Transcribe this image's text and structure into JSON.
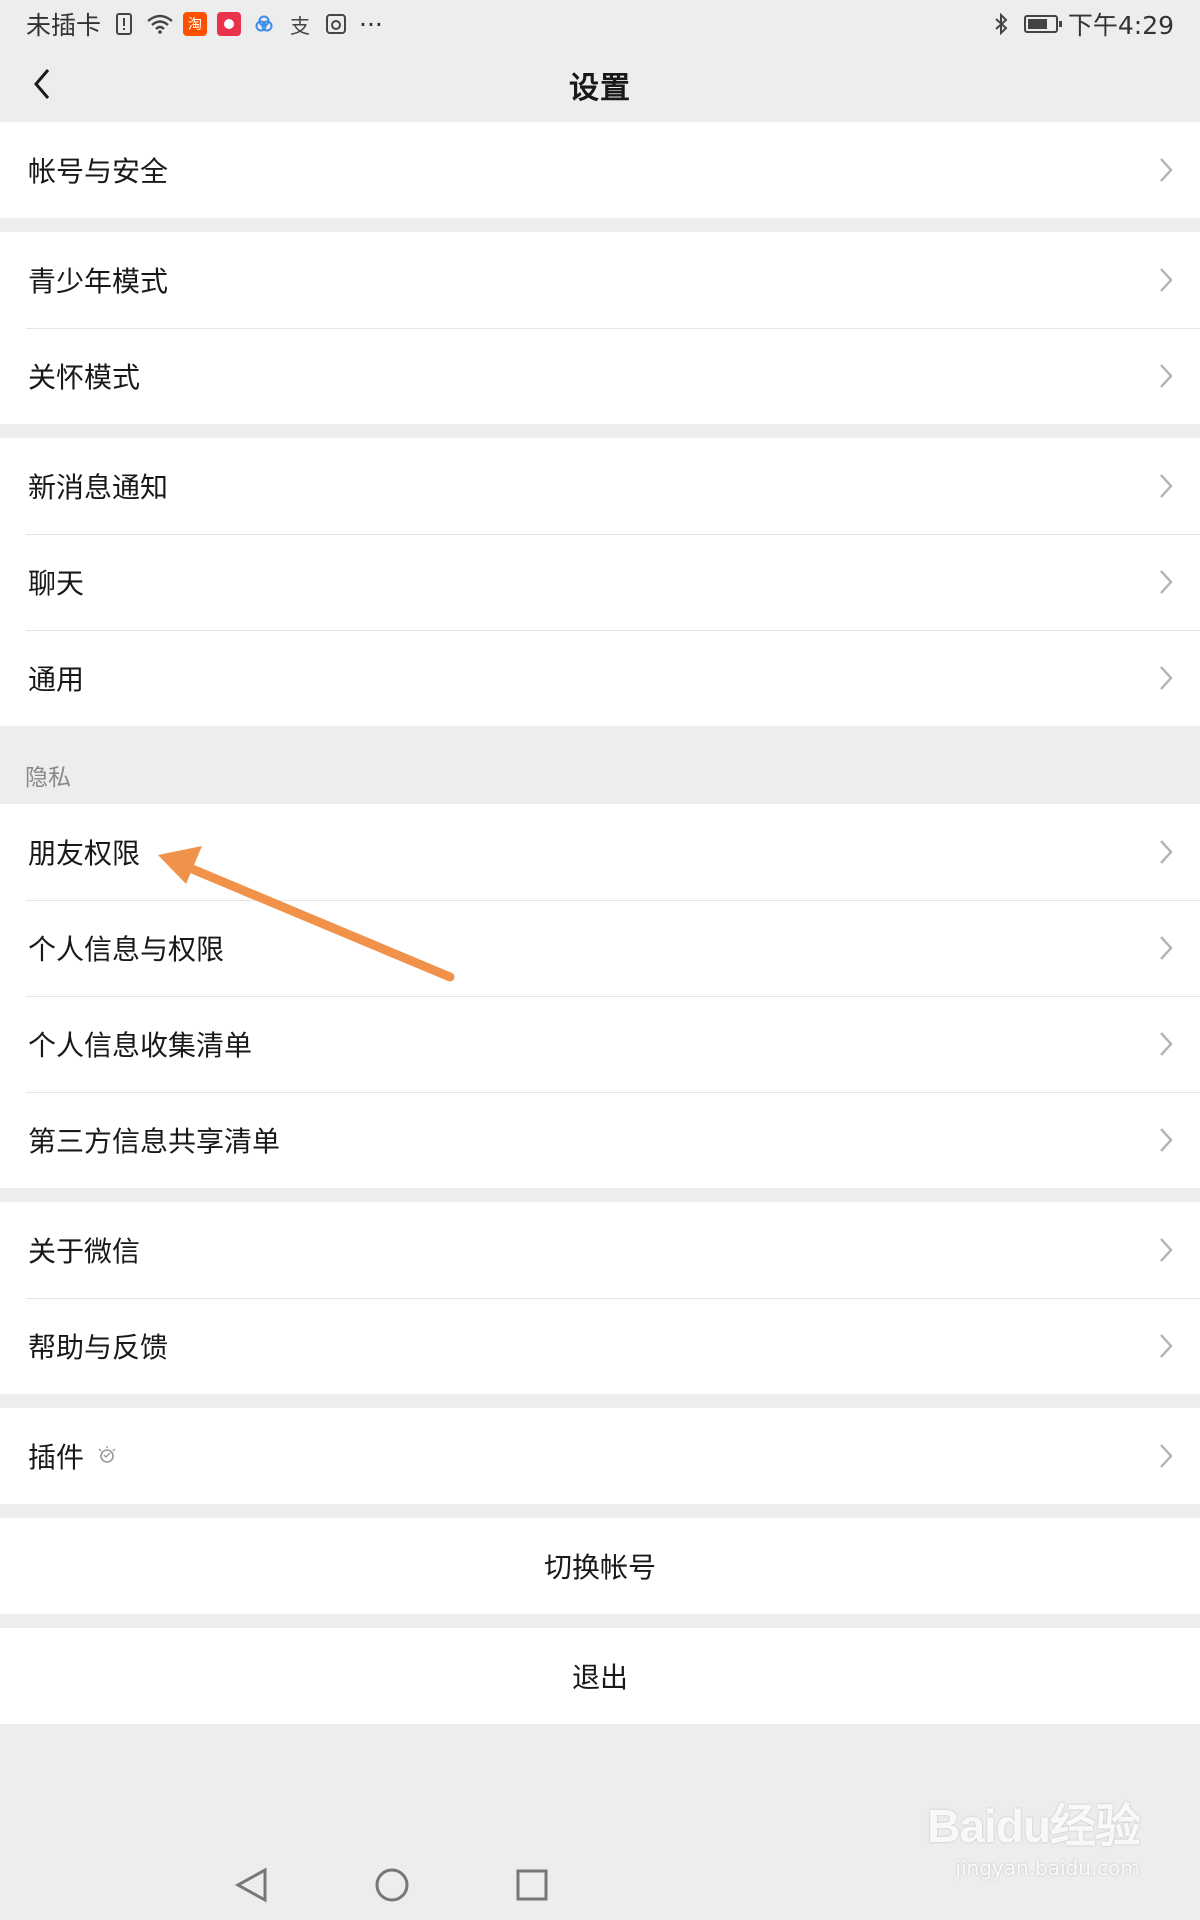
{
  "status_bar": {
    "carrier": "未插卡",
    "time": "下午4:29",
    "more": "···",
    "apps": [
      "淘",
      "支"
    ]
  },
  "header": {
    "title": "设置"
  },
  "groups": [
    {
      "items": [
        "帐号与安全"
      ]
    },
    {
      "items": [
        "青少年模式",
        "关怀模式"
      ]
    },
    {
      "items": [
        "新消息通知",
        "聊天",
        "通用"
      ]
    }
  ],
  "privacy": {
    "section_label": "隐私",
    "items": [
      "朋友权限",
      "个人信息与权限",
      "个人信息收集清单",
      "第三方信息共享清单"
    ]
  },
  "about_group": {
    "items": [
      "关于微信",
      "帮助与反馈"
    ]
  },
  "plugins": {
    "label": "插件",
    "icon": "bulb-icon"
  },
  "actions": {
    "switch_account": "切换帐号",
    "logout": "退出"
  },
  "watermark": {
    "main": "Baidu经验",
    "url": "jingyan.baidu.com"
  },
  "colors": {
    "background": "#ededed",
    "card": "#ffffff",
    "divider": "#e5e5e5",
    "annotation_arrow": "#f0924a"
  }
}
